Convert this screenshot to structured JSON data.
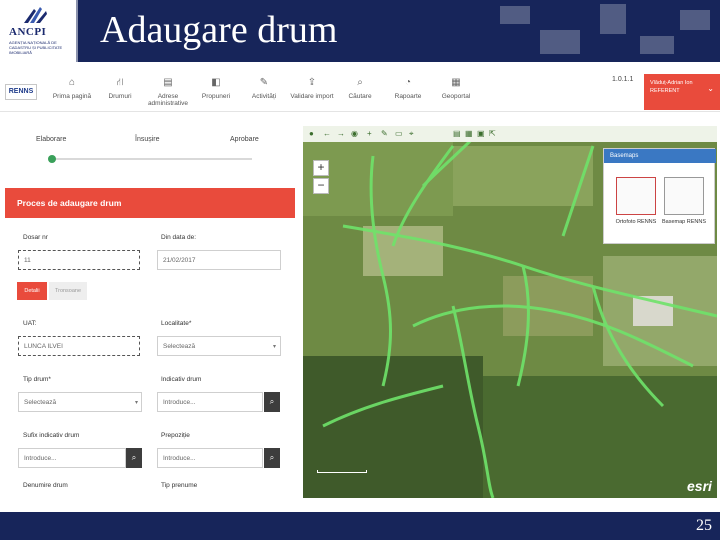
{
  "slide": {
    "title": "Adaugare drum",
    "page_number": "25",
    "logo_text": "ANCPI",
    "logo_subtext": "AGENȚIA NAȚIONALĂ DE CADASTRU ȘI PUBLICITATE IMOBILIARĂ"
  },
  "app": {
    "renns_label": "RENNS",
    "nav": [
      {
        "label": "Prima pagină",
        "icon": "home-icon"
      },
      {
        "label": "Drumuri",
        "icon": "road-icon"
      },
      {
        "label": "Adrese administrative",
        "icon": "document-icon"
      },
      {
        "label": "Propuneri",
        "icon": "proposal-icon"
      },
      {
        "label": "Activități",
        "icon": "edit-icon"
      },
      {
        "label": "Validare import",
        "icon": "upload-icon"
      },
      {
        "label": "Căutare",
        "icon": "search-icon"
      },
      {
        "label": "Rapoarte",
        "icon": "report-icon"
      },
      {
        "label": "Geoportal",
        "icon": "map-icon"
      }
    ],
    "version": "1.0.1.1",
    "user": {
      "line1": "Vlăduț-Adrian Ion",
      "line2": "REFERENT"
    }
  },
  "workflow": {
    "steps": [
      "Elaborare",
      "Însușire",
      "Aprobare"
    ],
    "active_step": 0
  },
  "form": {
    "header": "Proces de adaugare drum",
    "dosar_label": "Dosar nr",
    "dosar_value": "11",
    "data_label": "Din data de:",
    "data_value": "21/02/2017",
    "tab_details": "Detalii",
    "tab_other": "Tronsoane",
    "uat_label": "UAT:",
    "uat_value": "LUNCA ILVEI",
    "localitate_label": "Localitate*",
    "localitate_placeholder": "Selectează",
    "tip_drum_label": "Tip drum*",
    "tip_drum_placeholder": "Selectează",
    "indicativ_label": "Indicativ drum",
    "indicativ_placeholder": "Introduce...",
    "sufix_label": "Sufix indicativ drum",
    "sufix_placeholder": "Introduce...",
    "prepozitie_label": "Prepoziție",
    "prepozitie_placeholder": "Introduce...",
    "denumire_label": "Denumire drum",
    "tip_prenume_label": "Tip prenume"
  },
  "map": {
    "basemaps_title": "Basemaps",
    "basemap_1": "Ortofoto RENNS",
    "basemap_2": "Basemap RENNS",
    "esri_label": "esri",
    "zoom_in": "+",
    "zoom_out": "−"
  }
}
